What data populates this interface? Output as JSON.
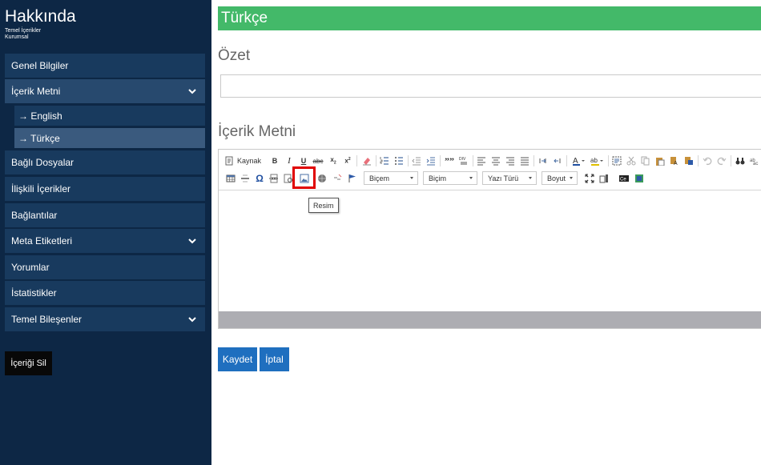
{
  "sidebar": {
    "title": "Hakkında",
    "subtitle_line1": "Temel İçerikler",
    "subtitle_line2": "Kurumsal",
    "items": [
      {
        "label": "Genel Bilgiler"
      },
      {
        "label": "İçerik Metni",
        "expanded": true
      },
      {
        "label": "→ English"
      },
      {
        "label": "→ Türkçe",
        "selected": true
      },
      {
        "label": "Bağlı Dosyalar"
      },
      {
        "label": "İlişkili İçerikler"
      },
      {
        "label": "Bağlantılar"
      },
      {
        "label": "Meta Etiketleri"
      },
      {
        "label": "Yorumlar"
      },
      {
        "label": "İstatistikler"
      },
      {
        "label": "Temel Bileşenler"
      }
    ],
    "delete_label": "İçeriği Sil"
  },
  "main": {
    "language_header": "Türkçe",
    "summary_label": "Özet",
    "summary_value": "",
    "content_label": "İçerik Metni",
    "editor": {
      "source_label": "Kaynak",
      "format_combo1": "Biçem",
      "format_combo2": "Biçim",
      "font_combo": "Yazı Türü",
      "size_combo": "Boyut",
      "tooltip": "Resim",
      "body_text": ""
    },
    "save_label": "Kaydet",
    "cancel_label": "İptal"
  },
  "colors": {
    "sidebar_bg": "#0d2745",
    "nav_item_bg": "#183a5e",
    "header_green": "#43b969",
    "button_blue": "#1f6fbf",
    "highlight_red": "#e00000"
  }
}
